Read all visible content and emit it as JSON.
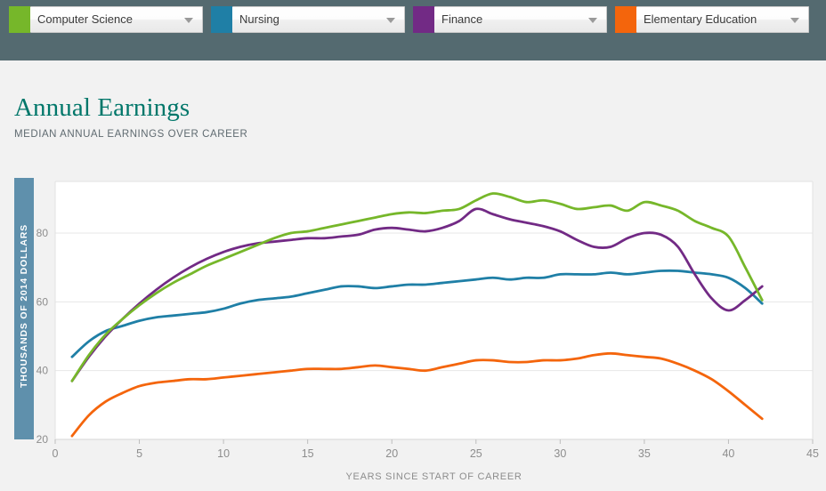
{
  "selectors": [
    {
      "label": "Computer Science",
      "color": "#76b72a",
      "icon": "chevron-down-icon"
    },
    {
      "label": "Nursing",
      "color": "#1f7fa6",
      "icon": "chevron-down-icon"
    },
    {
      "label": "Finance",
      "color": "#722a85",
      "icon": "chevron-down-icon"
    },
    {
      "label": "Elementary Education",
      "color": "#f4650c",
      "icon": "chevron-down-icon"
    }
  ],
  "headline": {
    "title": "Annual Earnings",
    "subtitle": "MEDIAN ANNUAL EARNINGS OVER CAREER",
    "title_color": "#00776a"
  },
  "axis": {
    "y_label": "THOUSANDS OF 2014 DOLLARS",
    "y_label_bar_color": "#5f90ac",
    "x_label": "YEARS SINCE START OF CAREER"
  },
  "chart_data": {
    "type": "line",
    "title": "Annual Earnings",
    "subtitle": "MEDIAN ANNUAL EARNINGS OVER CAREER",
    "xlabel": "YEARS SINCE START OF CAREER",
    "ylabel": "THOUSANDS OF 2014 DOLLARS",
    "xlim": [
      0,
      45
    ],
    "ylim": [
      20,
      95
    ],
    "xticks": [
      0,
      5,
      10,
      15,
      20,
      25,
      30,
      35,
      40,
      45
    ],
    "yticks": [
      20,
      40,
      60,
      80
    ],
    "grid": "horizontal",
    "legend": "top-selectors",
    "x": [
      1,
      2,
      3,
      4,
      5,
      6,
      7,
      8,
      9,
      10,
      11,
      12,
      13,
      14,
      15,
      16,
      17,
      18,
      19,
      20,
      21,
      22,
      23,
      24,
      25,
      26,
      27,
      28,
      29,
      30,
      31,
      32,
      33,
      34,
      35,
      36,
      37,
      38,
      39,
      40,
      41,
      42
    ],
    "series": [
      {
        "name": "Computer Science",
        "color": "#76b72a",
        "values": [
          37.0,
          44.5,
          50.5,
          55.0,
          59.0,
          62.5,
          65.5,
          68.0,
          70.5,
          72.5,
          74.5,
          76.5,
          78.5,
          80.0,
          80.5,
          81.5,
          82.5,
          83.5,
          84.5,
          85.5,
          86.0,
          85.8,
          86.5,
          87.0,
          89.5,
          91.5,
          90.5,
          89.0,
          89.5,
          88.5,
          87.0,
          87.5,
          88.0,
          86.5,
          89.0,
          88.0,
          86.5,
          83.5,
          81.5,
          79.0,
          70.0,
          60.5
        ]
      },
      {
        "name": "Nursing",
        "color": "#1f7fa6",
        "values": [
          44.0,
          48.5,
          51.5,
          53.0,
          54.5,
          55.5,
          56.0,
          56.5,
          57.0,
          58.0,
          59.5,
          60.5,
          61.0,
          61.5,
          62.5,
          63.5,
          64.5,
          64.5,
          64.0,
          64.5,
          65.0,
          65.0,
          65.5,
          66.0,
          66.5,
          67.0,
          66.5,
          67.0,
          67.0,
          68.0,
          68.0,
          68.0,
          68.5,
          68.0,
          68.5,
          69.0,
          69.0,
          68.5,
          68.0,
          67.0,
          64.0,
          59.5
        ]
      },
      {
        "name": "Finance",
        "color": "#722a85",
        "values": [
          37.0,
          44.0,
          50.0,
          55.0,
          59.5,
          63.5,
          67.0,
          70.0,
          72.5,
          74.5,
          76.0,
          77.0,
          77.5,
          78.0,
          78.5,
          78.5,
          79.0,
          79.5,
          81.0,
          81.5,
          81.0,
          80.5,
          81.5,
          83.5,
          87.0,
          85.5,
          84.0,
          83.0,
          82.0,
          80.5,
          78.0,
          76.0,
          76.0,
          78.5,
          80.0,
          79.5,
          76.0,
          68.0,
          61.0,
          57.5,
          60.5,
          64.5
        ]
      },
      {
        "name": "Elementary Education",
        "color": "#f4650c",
        "values": [
          21.0,
          27.0,
          31.0,
          33.5,
          35.5,
          36.5,
          37.0,
          37.5,
          37.5,
          38.0,
          38.5,
          39.0,
          39.5,
          40.0,
          40.5,
          40.5,
          40.5,
          41.0,
          41.5,
          41.0,
          40.5,
          40.0,
          41.0,
          42.0,
          43.0,
          43.0,
          42.5,
          42.5,
          43.0,
          43.0,
          43.5,
          44.5,
          45.0,
          44.5,
          44.0,
          43.5,
          42.0,
          40.0,
          37.5,
          34.0,
          30.0,
          26.0
        ]
      }
    ]
  }
}
